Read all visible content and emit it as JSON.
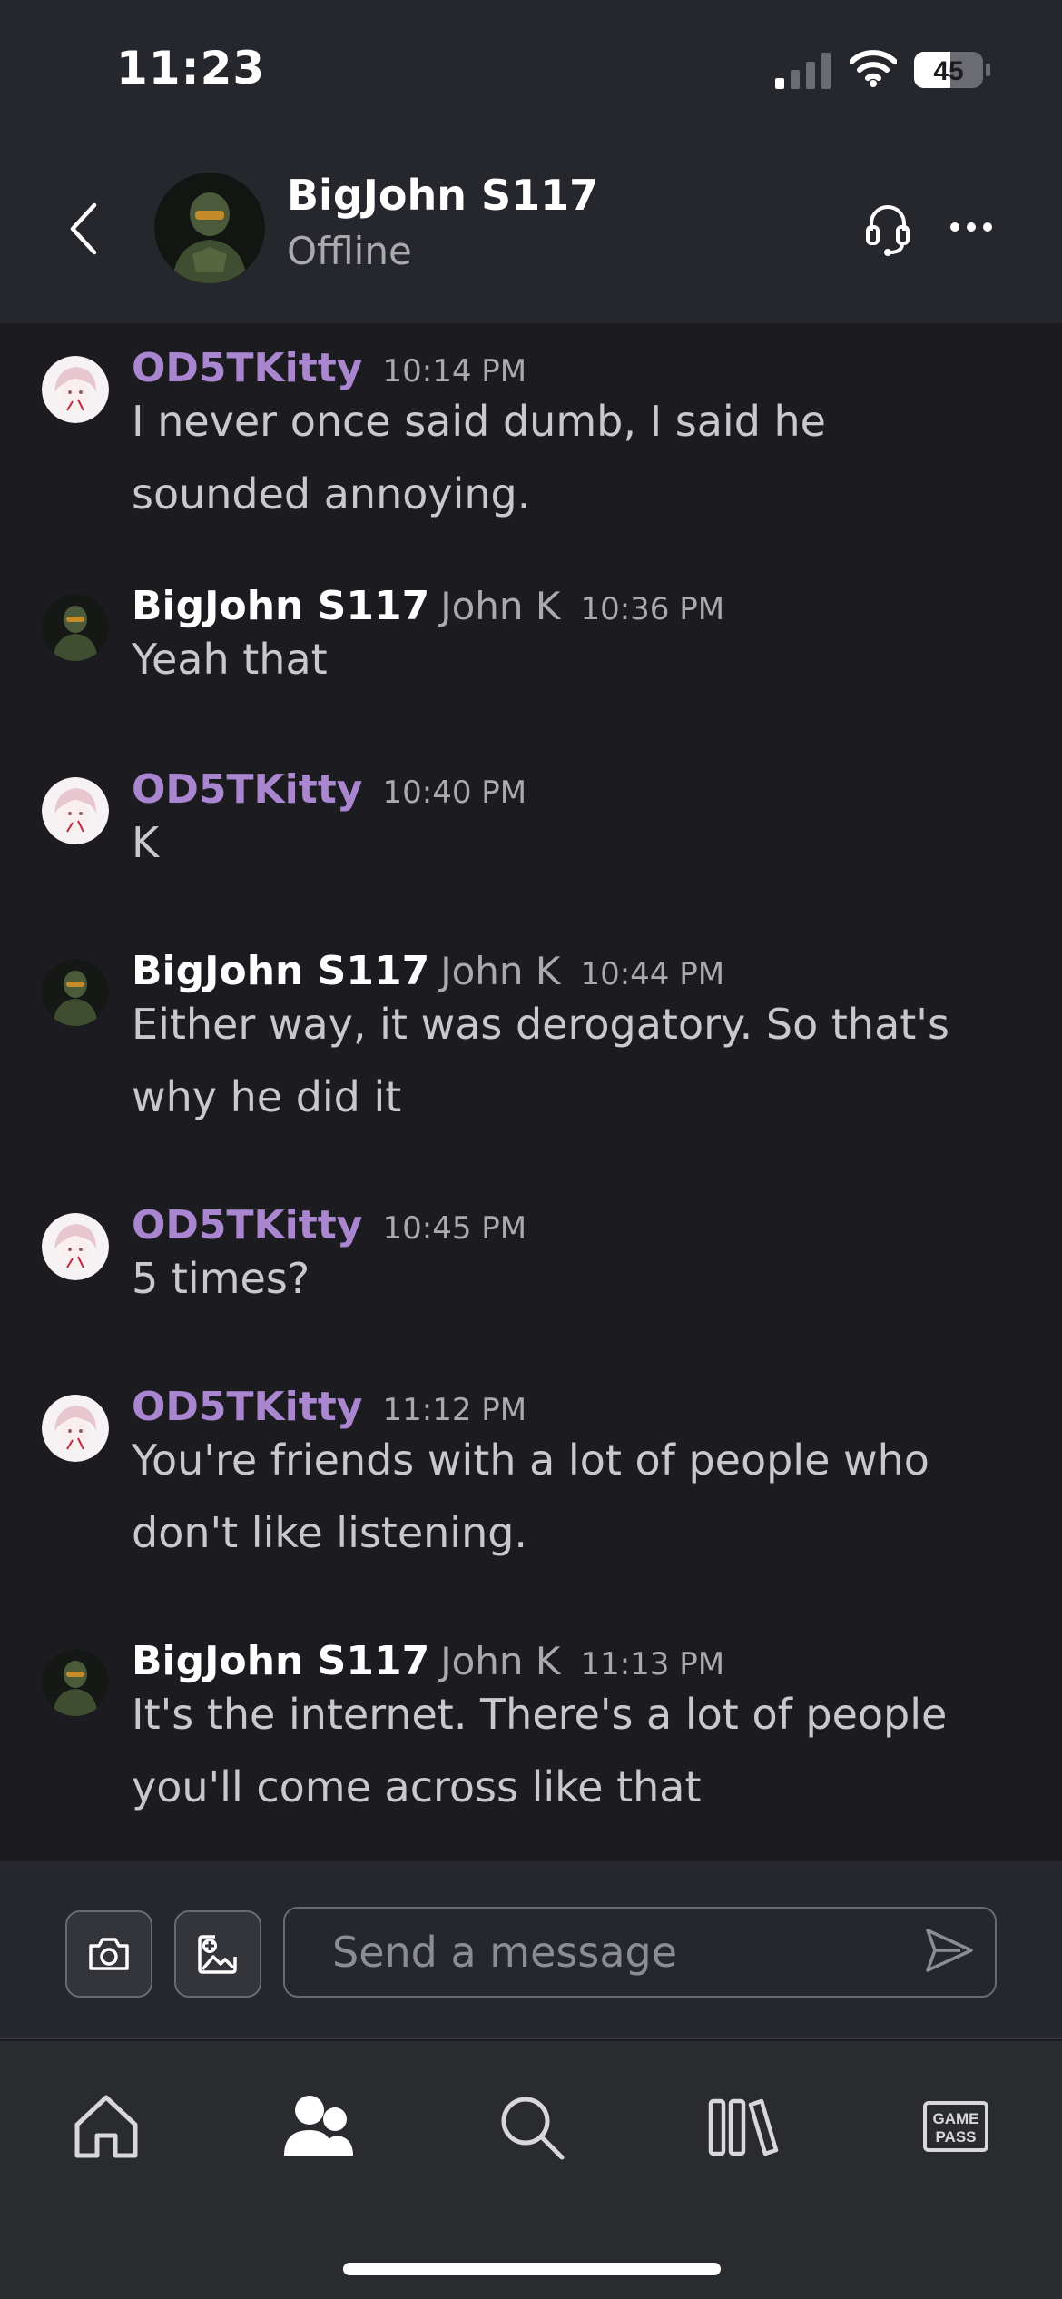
{
  "status_bar": {
    "time": "11:23",
    "battery": "45"
  },
  "header": {
    "contact_name": "BigJohn S117",
    "contact_status": "Offline",
    "back_icon": "chevron-left-icon",
    "headset_icon": "headset-icon",
    "more_icon": "more-horizontal-icon"
  },
  "messages": [
    {
      "sender": "OD5TKitty",
      "real_name": "",
      "time": "10:14 PM",
      "text": "I never once said dumb, I said he sounded annoying.",
      "avatar": "anime-girl-avatar"
    },
    {
      "sender": "BigJohn S117",
      "real_name": "John K",
      "time": "10:36 PM",
      "text": "Yeah that",
      "avatar": "master-chief-avatar"
    },
    {
      "sender": "OD5TKitty",
      "real_name": "",
      "time": "10:40 PM",
      "text": "K",
      "avatar": "anime-girl-avatar"
    },
    {
      "sender": "BigJohn S117",
      "real_name": "John K",
      "time": "10:44 PM",
      "text": "Either way, it was derogatory. So that's why he did it",
      "avatar": "master-chief-avatar"
    },
    {
      "sender": "OD5TKitty",
      "real_name": "",
      "time": "10:45 PM",
      "text": "5 times?",
      "avatar": "anime-girl-avatar"
    },
    {
      "sender": "OD5TKitty",
      "real_name": "",
      "time": "11:12 PM",
      "text": "You're friends with a lot of people who don't like listening.",
      "avatar": "anime-girl-avatar"
    },
    {
      "sender": "BigJohn S117",
      "real_name": "John K",
      "time": "11:13 PM",
      "text": "It's the internet. There's a lot of people you'll come across like that",
      "avatar": "master-chief-avatar"
    }
  ],
  "composer": {
    "placeholder": "Send a message",
    "camera_icon": "camera-icon",
    "image_icon": "add-image-icon",
    "send_icon": "send-icon"
  },
  "bottom_nav": {
    "items": [
      {
        "icon": "home-icon",
        "active": false
      },
      {
        "icon": "friends-icon",
        "active": true
      },
      {
        "icon": "search-icon",
        "active": false
      },
      {
        "icon": "library-icon",
        "active": false
      },
      {
        "icon": "game-pass-icon",
        "label": "GAME PASS",
        "active": false
      }
    ]
  },
  "colors": {
    "kitty_name": "#a986cf",
    "john_name": "#ffffff",
    "background": "#1c1c20",
    "header_bg": "#26272c"
  }
}
